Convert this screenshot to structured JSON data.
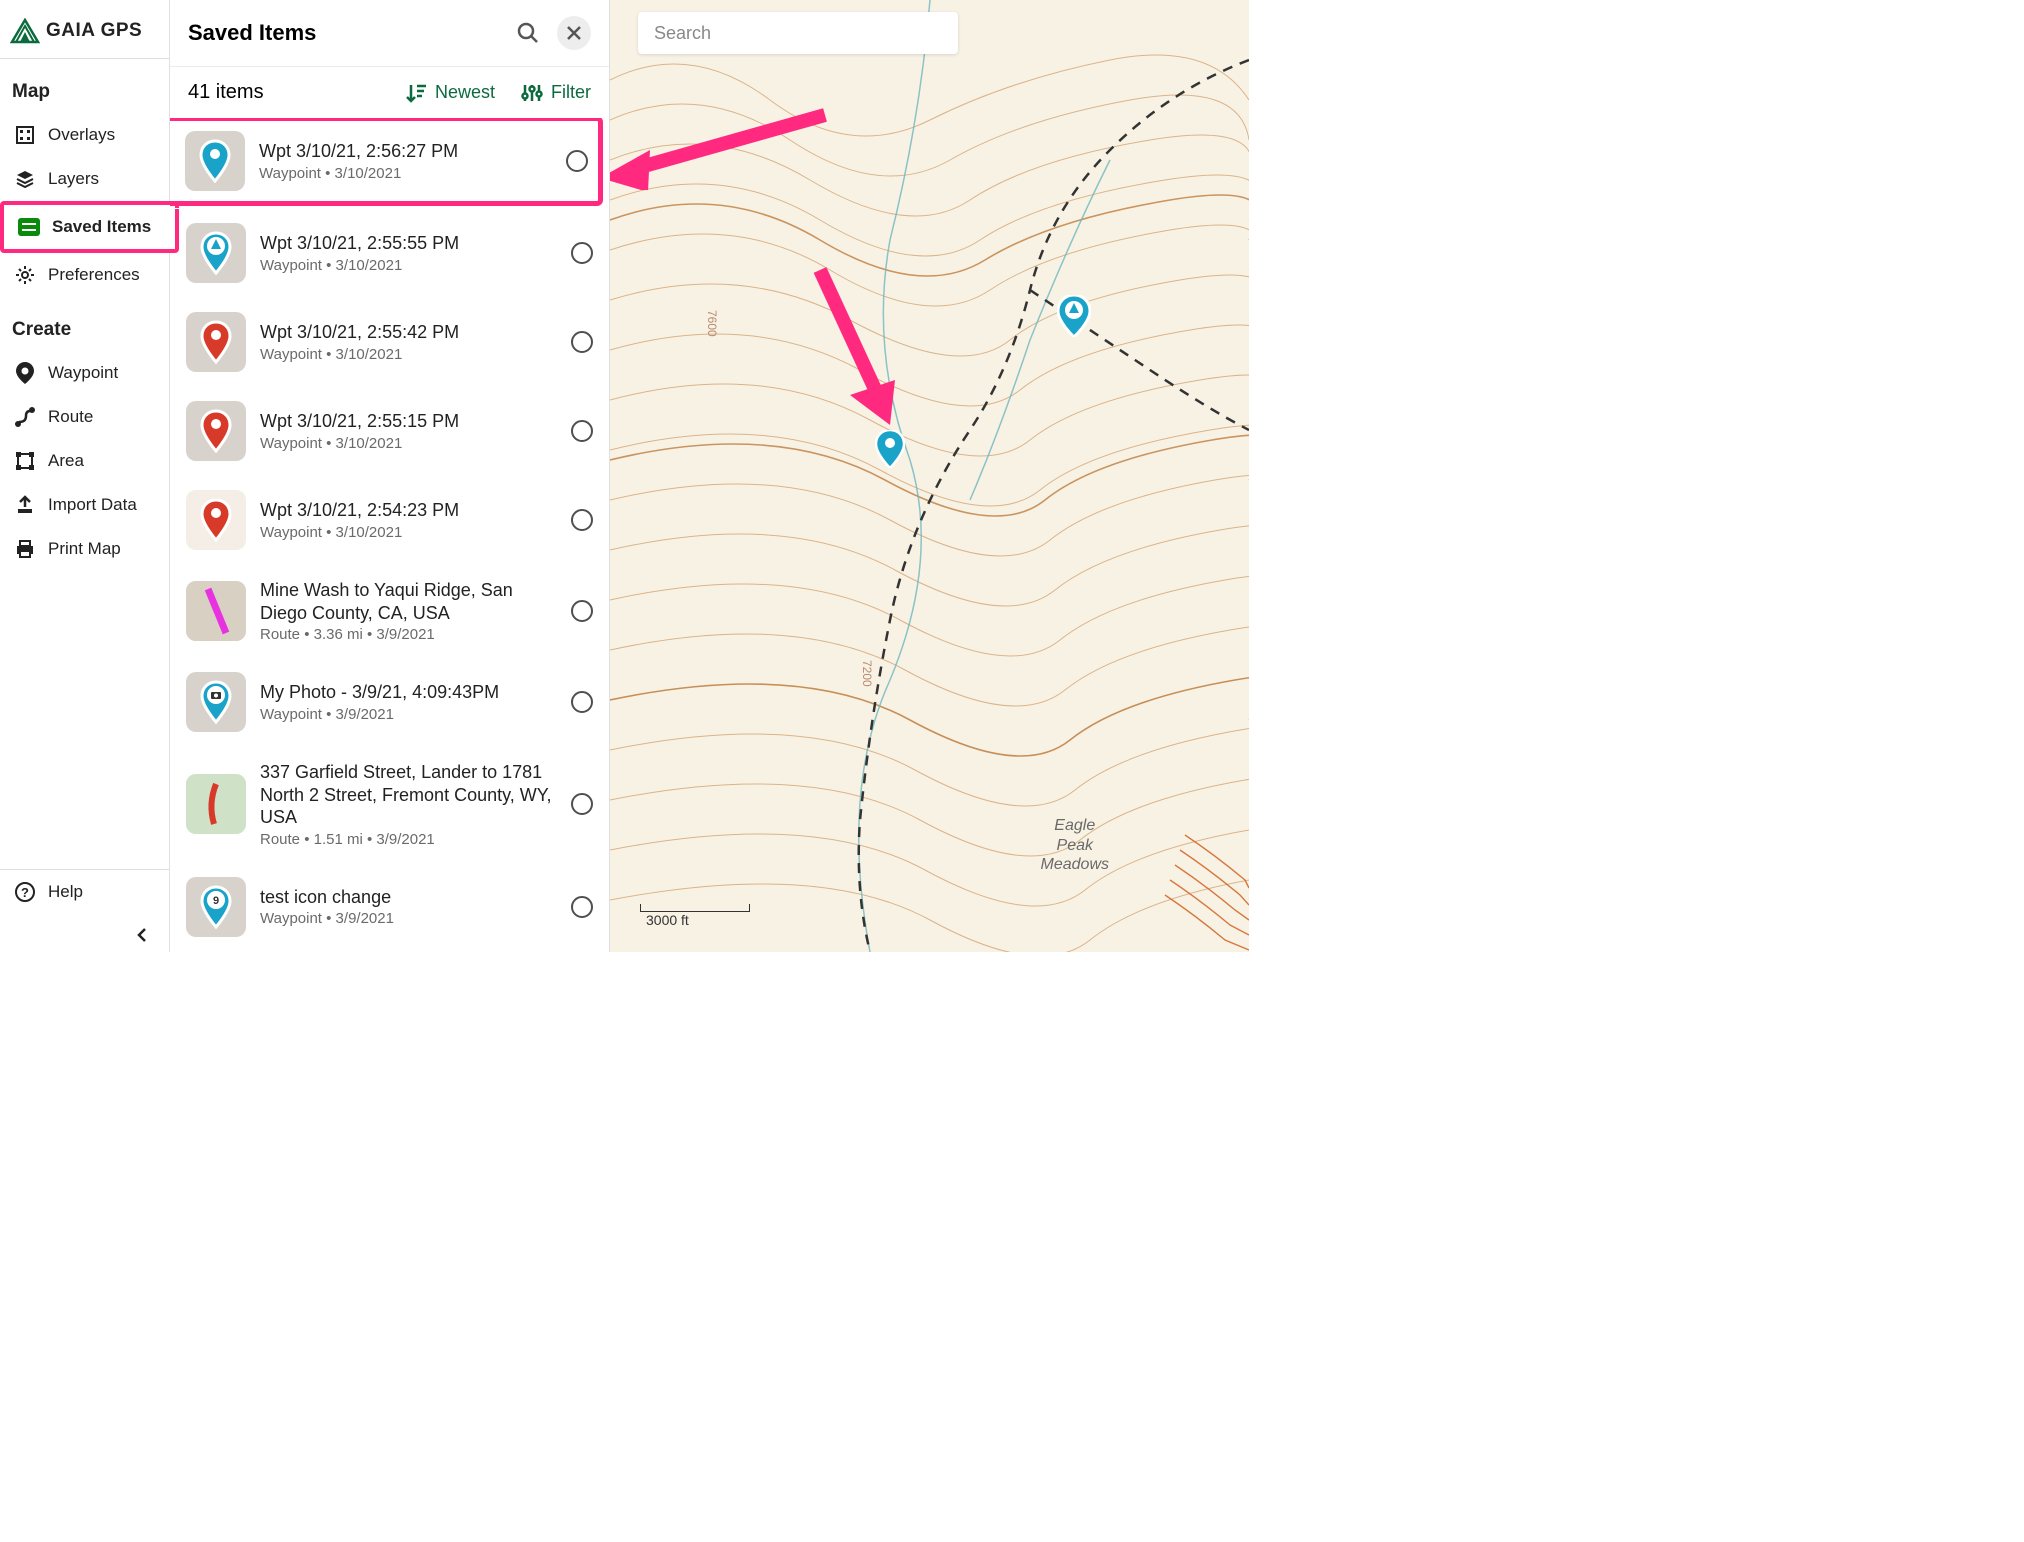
{
  "brand": "GAIA GPS",
  "sidebar": {
    "sections": {
      "map": {
        "header": "Map",
        "items": [
          "Overlays",
          "Layers",
          "Saved Items",
          "Preferences"
        ]
      },
      "create": {
        "header": "Create",
        "items": [
          "Waypoint",
          "Route",
          "Area",
          "Import Data",
          "Print Map"
        ]
      }
    },
    "help": "Help"
  },
  "panel": {
    "title": "Saved Items",
    "count_label": "41 items",
    "sort_label": "Newest",
    "filter_label": "Filter"
  },
  "map": {
    "search_placeholder": "Search",
    "scale_label": "3000 ft",
    "place_label": "Eagle\nPeak\nMeadows",
    "contours": [
      "7600",
      "7200"
    ]
  },
  "colors": {
    "accent_pink": "#ff2a7f",
    "accent_green": "#0c6b3e",
    "marker_teal": "#1aa3c9",
    "marker_red": "#d83a2a"
  },
  "items": [
    {
      "title": "Wpt 3/10/21, 2:56:27 PM",
      "sub": "Waypoint • 3/10/2021",
      "thumb": "teal-pin",
      "highlighted": true
    },
    {
      "title": "Wpt 3/10/21, 2:55:55 PM",
      "sub": "Waypoint • 3/10/2021",
      "thumb": "tree-pin"
    },
    {
      "title": "Wpt 3/10/21, 2:55:42 PM",
      "sub": "Waypoint • 3/10/2021",
      "thumb": "red-pin"
    },
    {
      "title": "Wpt 3/10/21, 2:55:15 PM",
      "sub": "Waypoint • 3/10/2021",
      "thumb": "red-pin"
    },
    {
      "title": "Wpt 3/10/21, 2:54:23 PM",
      "sub": "Waypoint • 3/10/2021",
      "thumb": "red-pin-light"
    },
    {
      "title": "Mine Wash to Yaqui Ridge, San Diego County, CA, USA",
      "sub": "Route • 3.36 mi • 3/9/2021",
      "thumb": "magenta-route"
    },
    {
      "title": "My Photo - 3/9/21, 4:09:43PM",
      "sub": "Waypoint • 3/9/2021",
      "thumb": "camera-pin"
    },
    {
      "title": "337 Garfield Street, Lander to 1781 North 2 Street, Fremont County, WY, USA",
      "sub": "Route • 1.51 mi • 3/9/2021",
      "thumb": "red-route"
    },
    {
      "title": "test icon change",
      "sub": "Waypoint • 3/9/2021",
      "thumb": "number-pin"
    }
  ]
}
